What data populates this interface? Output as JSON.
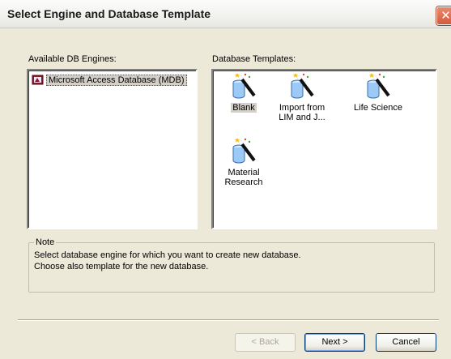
{
  "window": {
    "title": "Select Engine and Database Template",
    "close_glyph": "✕"
  },
  "engines": {
    "label": "Available DB Engines:",
    "items": [
      {
        "label": "Microsoft Access Database (MDB)",
        "icon": "access-db-icon",
        "selected": true
      }
    ]
  },
  "templates": {
    "label": "Database Templates:",
    "items": [
      {
        "label": "Blank",
        "icon": "database-wand-icon",
        "selected": true
      },
      {
        "label": "Import from LIM and J...",
        "icon": "database-wand-icon",
        "selected": false
      },
      {
        "label": "Life Science",
        "icon": "database-wand-icon",
        "selected": false
      },
      {
        "label": "Material Research",
        "icon": "database-wand-icon",
        "selected": false
      }
    ]
  },
  "note": {
    "title": "Note",
    "line1": "Select database engine for which you want to create new database.",
    "line2": "Choose also template for the new database."
  },
  "buttons": {
    "back": "< Back",
    "next": "Next >",
    "cancel": "Cancel"
  }
}
